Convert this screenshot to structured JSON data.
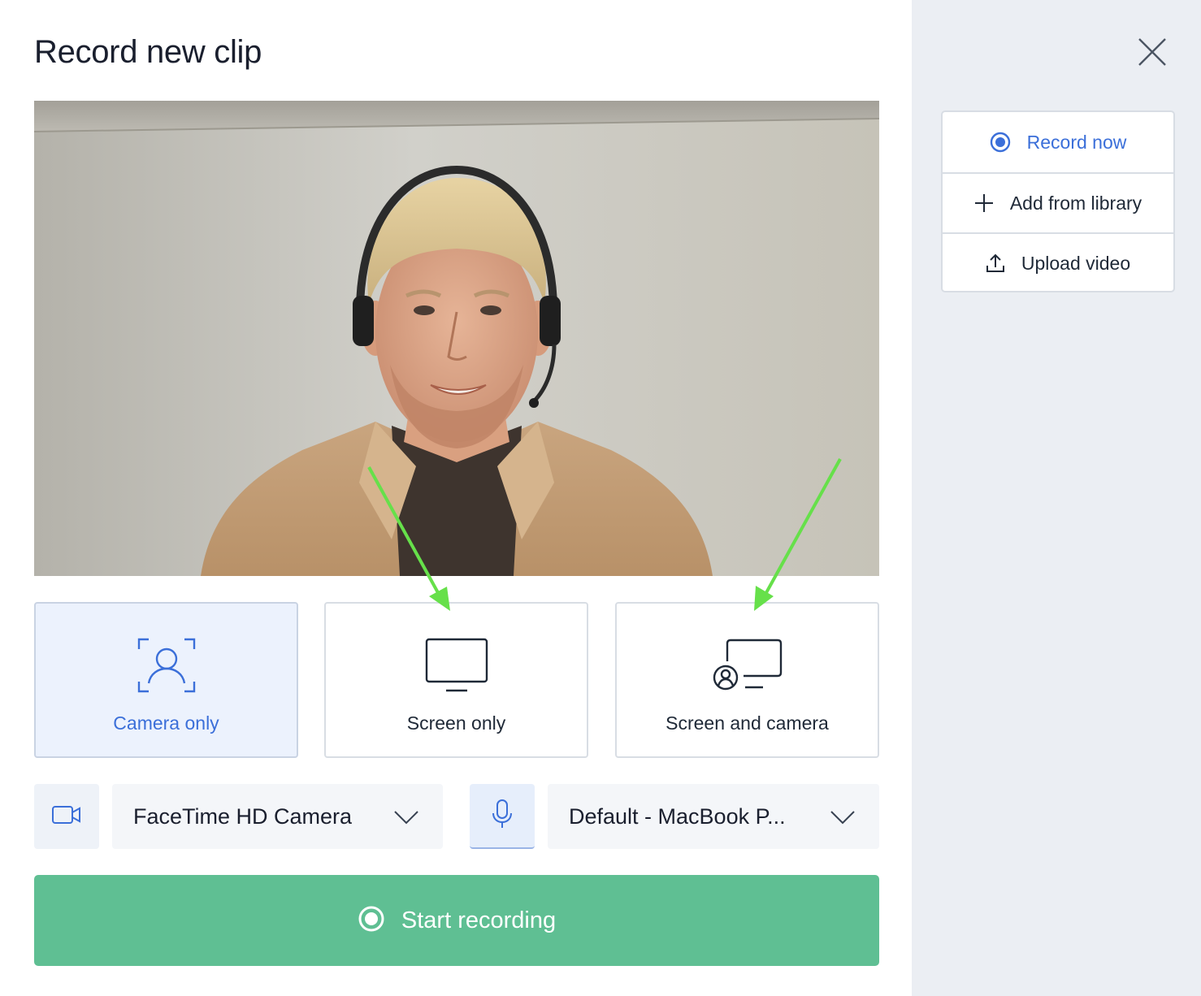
{
  "dialog": {
    "title": "Record new clip",
    "close_icon": "close-icon"
  },
  "preview": {
    "icon": "camera-preview"
  },
  "modes": [
    {
      "label": "Camera only",
      "icon": "camera-frame-icon",
      "selected": true
    },
    {
      "label": "Screen only",
      "icon": "monitor-icon",
      "selected": false
    },
    {
      "label": "Screen and camera",
      "icon": "screen-camera-icon",
      "selected": false
    }
  ],
  "devices": {
    "camera_icon": "video-camera-icon",
    "camera_value": "FaceTime HD Camera",
    "mic_icon": "microphone-icon",
    "mic_value": "Default - MacBook P..."
  },
  "start_button": {
    "label": "Start recording",
    "icon": "record-icon"
  },
  "sidebar": {
    "actions": [
      {
        "label": "Record now",
        "icon": "record-radio-icon",
        "active": true
      },
      {
        "label": "Add from library",
        "icon": "plus-icon",
        "active": false
      },
      {
        "label": "Upload video",
        "icon": "upload-icon",
        "active": false
      }
    ]
  },
  "colors": {
    "accent": "#3b6fd9",
    "record_green": "#5fbf93",
    "annotation_arrow": "#66e04a",
    "sidebar_bg": "#ebeef3"
  }
}
